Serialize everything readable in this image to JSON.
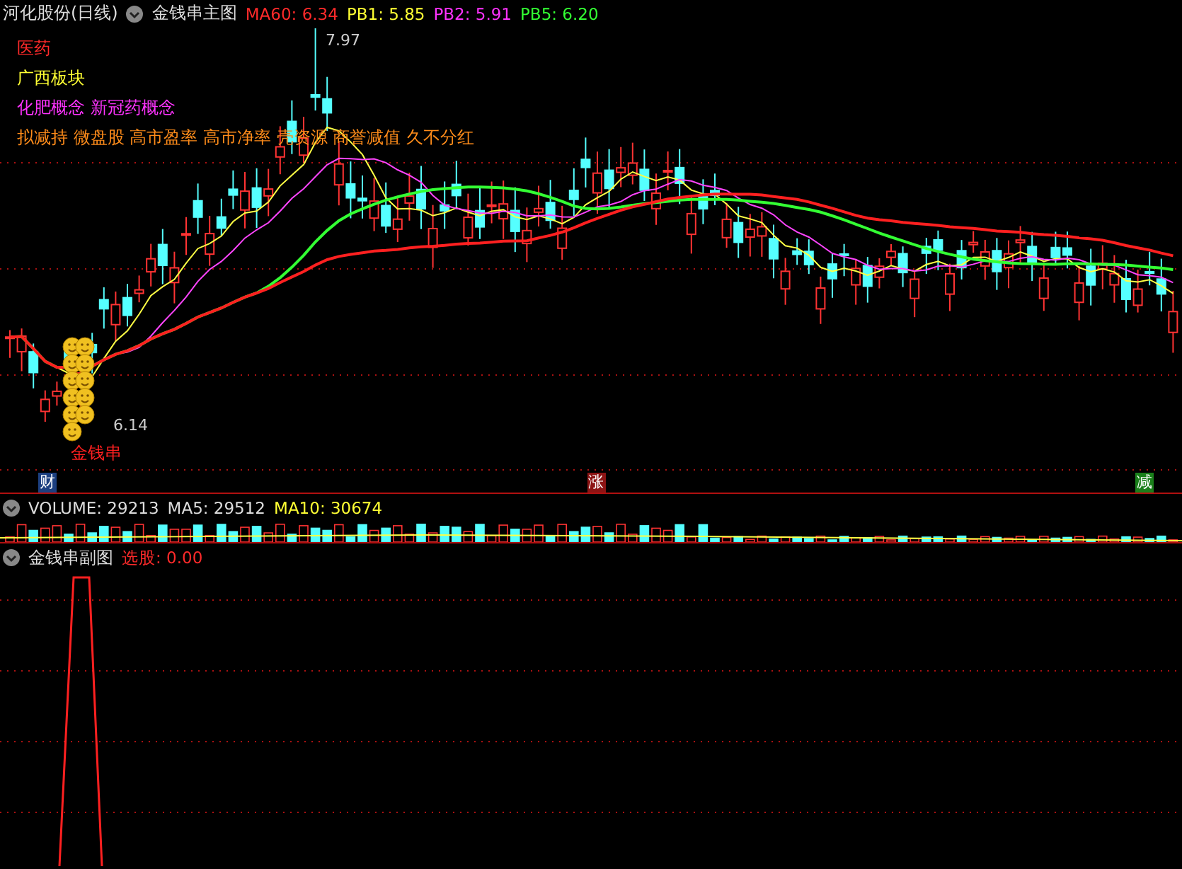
{
  "header": {
    "title": "河化股份(日线)",
    "indicator": "金钱串主图",
    "readings": [
      {
        "label": "MA60: 6.34",
        "color": "#ff2a2a"
      },
      {
        "label": "PB1: 5.85",
        "color": "#ffff33"
      },
      {
        "label": "PB2: 5.91",
        "color": "#ff33ff"
      },
      {
        "label": "PB5: 6.20",
        "color": "#33ff33"
      }
    ]
  },
  "tags": [
    {
      "text": "医药",
      "color": "#ff2a2a"
    },
    {
      "text": "广西板块",
      "color": "#ffff33"
    },
    {
      "text": "化肥概念 新冠药概念",
      "color": "#ff33ff"
    },
    {
      "text": "拟减持 微盘股 高市盈率 高市净率 壳资源 商誉减值 久不分红",
      "color": "#ff8c1a"
    }
  ],
  "main_chart": {
    "high_label": "7.97",
    "low_label": "6.14",
    "signal_label": "金钱串"
  },
  "markers": [
    {
      "text": "财",
      "color": "#1c3f80"
    },
    {
      "text": "涨",
      "color": "#8c1414"
    },
    {
      "text": "减",
      "color": "#1a7f1a"
    }
  ],
  "volume_panel": {
    "readings": [
      {
        "label": "VOLUME: 29213",
        "color": "#dddddd"
      },
      {
        "label": "MA5: 29512",
        "color": "#dddddd"
      },
      {
        "label": "MA10: 30674",
        "color": "#ffff33"
      }
    ]
  },
  "sub_panel": {
    "title": "金钱串副图",
    "readings": [
      {
        "label": "选股: 0.00",
        "color": "#ff2a2a"
      }
    ]
  }
}
